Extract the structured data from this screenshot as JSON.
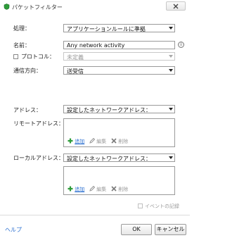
{
  "window": {
    "title": "パケットフィルター"
  },
  "form": {
    "action": {
      "label": "処理：",
      "value": "アプリケーションルールに準拠"
    },
    "name": {
      "label": "名前：",
      "value": "Any network activity"
    },
    "protocol": {
      "label": "プロトコル：",
      "value": "未定義",
      "checked": false
    },
    "direction": {
      "label": "通信方向：",
      "value": "送受信"
    }
  },
  "address": {
    "label": "アドレス：",
    "value": "設定したネットワークアドレス：",
    "remote_label": "リモートアドレス：",
    "remote_toolbar": {
      "add": "追加",
      "edit": "編集",
      "delete": "削除"
    },
    "local_label": "ローカルアドレス：",
    "local_value": "設定したネットワークアドレス：",
    "local_toolbar": {
      "add": "追加",
      "edit": "編集",
      "delete": "削除"
    }
  },
  "event_log": {
    "label": "イベントの記録",
    "checked": false
  },
  "footer": {
    "help": "ヘルプ",
    "ok": "OK",
    "cancel": "キャンセル"
  }
}
